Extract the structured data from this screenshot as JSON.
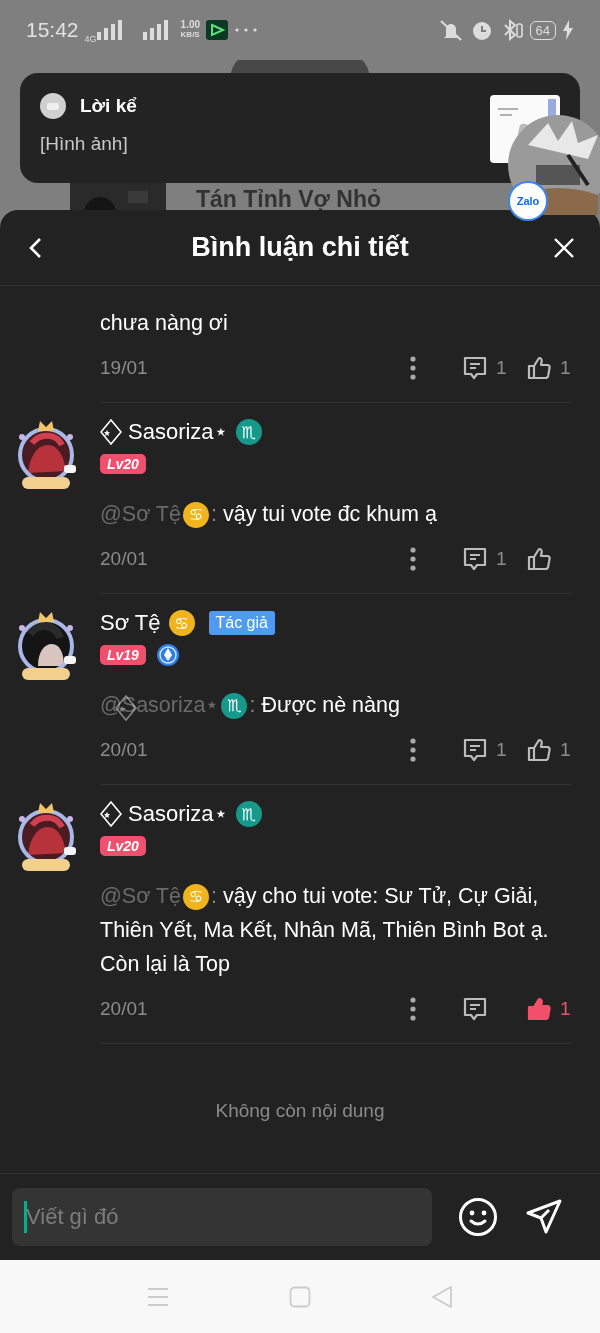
{
  "status_bar": {
    "time": "15:42",
    "network": "4G",
    "speed": "1.00",
    "speed_unit": "KB/S",
    "battery": "64"
  },
  "background_page": {
    "title_fragment": "Tán Tỉnh Vợ Nhỏ"
  },
  "notification": {
    "title": "Lời kể",
    "body": "[Hình ảnh]"
  },
  "chat_bubble": {
    "badge": "Zalo"
  },
  "sheet": {
    "title": "Bình luận chi tiết"
  },
  "comments": [
    {
      "partial": true,
      "text": "chưa nàng ơi",
      "date": "19/01",
      "replies": "1",
      "likes": "1",
      "liked": false
    },
    {
      "partial": false,
      "user": {
        "name": "Sasoriza⋆",
        "fancy": true,
        "zodiac": {
          "glyph": "♏",
          "color": "#16998a"
        },
        "level": "Lv20",
        "pen_badge": false
      },
      "mention": {
        "name": "@Sơ Tệ",
        "fancy": false,
        "zodiac": {
          "glyph": "♋",
          "color": "#f0b51c"
        }
      },
      "separator": ":",
      "text": "vậy tui vote đc khum ạ",
      "date": "20/01",
      "replies": "1",
      "liked": false
    },
    {
      "partial": false,
      "user": {
        "name": "Sơ Tệ",
        "fancy": false,
        "zodiac": {
          "glyph": "♋",
          "color": "#f0b51c"
        },
        "author_tag": "Tác giả",
        "level": "Lv19",
        "pen_badge": true
      },
      "mention": {
        "name": "@Sasoriza⋆",
        "fancy": true,
        "zodiac": {
          "glyph": "♏",
          "color": "#16998a"
        }
      },
      "separator": ":",
      "text": "Được nè nàng",
      "date": "20/01",
      "replies": "1",
      "likes": "1",
      "liked": false
    },
    {
      "partial": false,
      "user": {
        "name": "Sasoriza⋆",
        "fancy": true,
        "zodiac": {
          "glyph": "♏",
          "color": "#16998a"
        },
        "level": "Lv20",
        "pen_badge": false
      },
      "mention": {
        "name": "@Sơ Tệ",
        "fancy": false,
        "zodiac": {
          "glyph": "♋",
          "color": "#f0b51c"
        }
      },
      "separator": ":",
      "text": "vậy cho tui vote: Sư Tử, Cự Giải, Thiên Yết, Ma Kết, Nhân Mã, Thiên Bình Bot ạ. Còn lại là Top",
      "date": "20/01",
      "likes": "1",
      "liked": true
    }
  ],
  "end_note": "Không còn nội dung",
  "composer": {
    "placeholder": "Viết gì đó"
  }
}
